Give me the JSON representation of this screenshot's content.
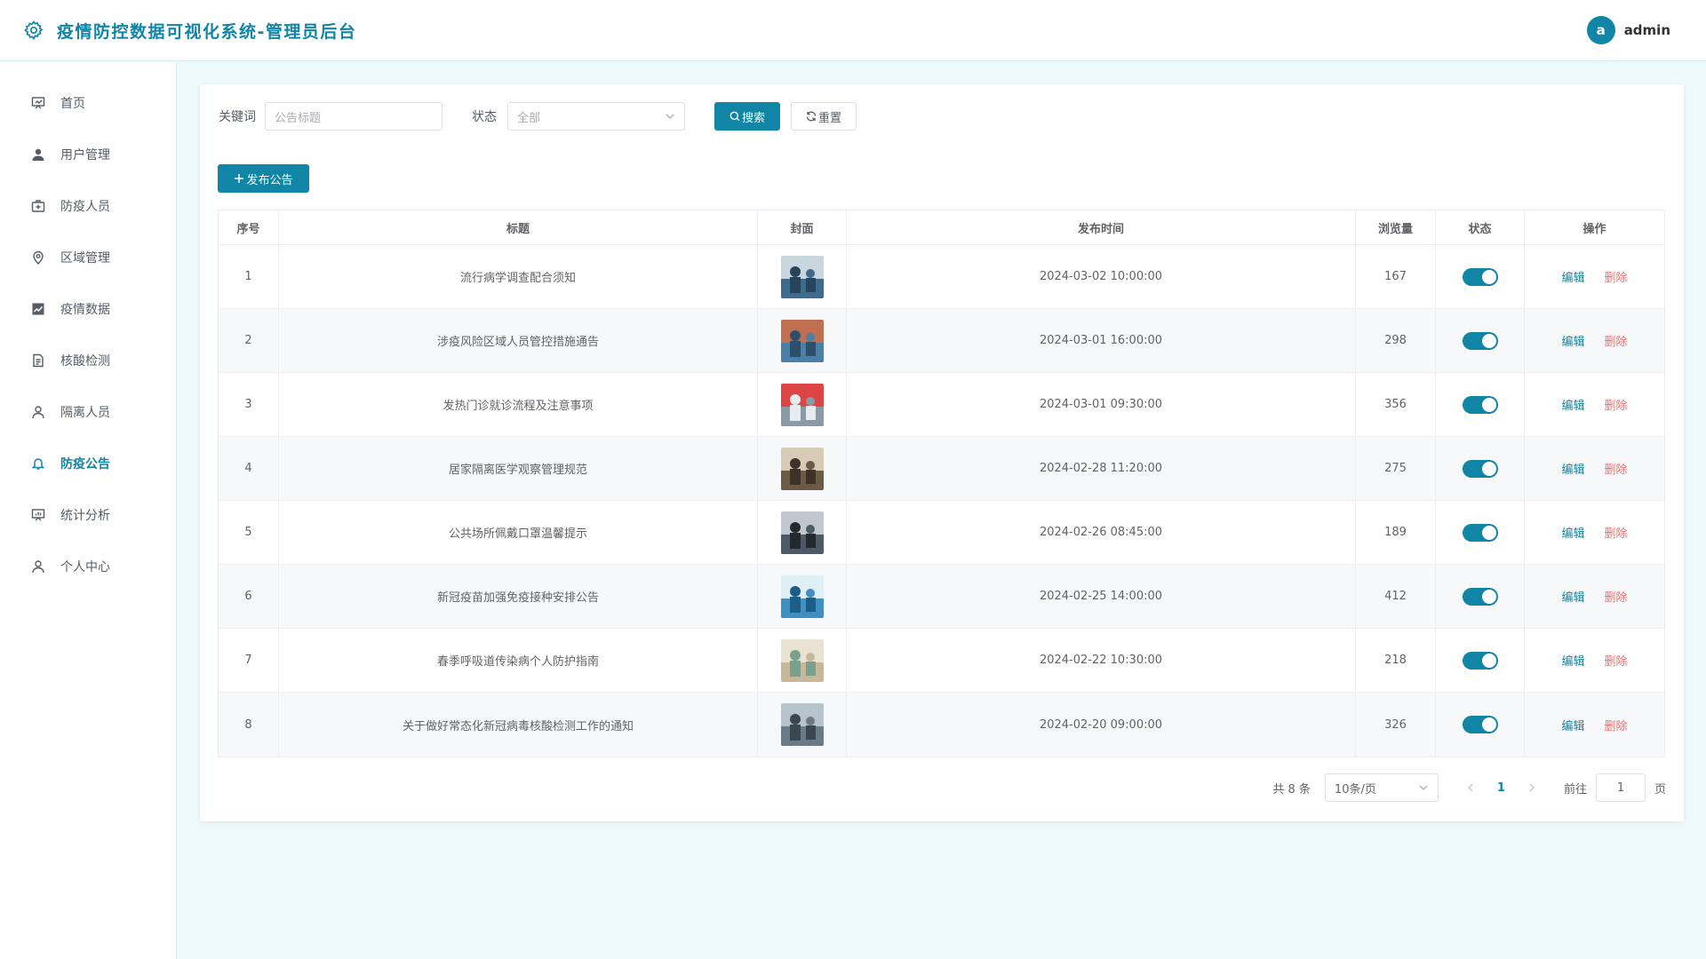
{
  "header": {
    "title": "疫情防控数据可视化系统-管理员后台",
    "avatar_letter": "a",
    "username": "admin"
  },
  "sidebar": {
    "items": [
      {
        "label": "首页",
        "icon": "dashboard-icon"
      },
      {
        "label": "用户管理",
        "icon": "user-icon"
      },
      {
        "label": "防疫人员",
        "icon": "medical-kit-icon"
      },
      {
        "label": "区域管理",
        "icon": "location-icon"
      },
      {
        "label": "疫情数据",
        "icon": "chart-icon"
      },
      {
        "label": "核酸检测",
        "icon": "document-icon"
      },
      {
        "label": "隔离人员",
        "icon": "person-icon"
      },
      {
        "label": "防疫公告",
        "icon": "bell-icon",
        "active": true
      },
      {
        "label": "统计分析",
        "icon": "analysis-icon"
      },
      {
        "label": "个人中心",
        "icon": "profile-icon"
      }
    ]
  },
  "filters": {
    "keyword_label": "关键词",
    "keyword_placeholder": "公告标题",
    "status_label": "状态",
    "status_value": "全部",
    "search_label": "搜索",
    "reset_label": "重置"
  },
  "toolbar": {
    "publish_label": "发布公告"
  },
  "table": {
    "columns": [
      "序号",
      "标题",
      "封面",
      "发布时间",
      "浏览量",
      "状态",
      "操作"
    ],
    "edit_label": "编辑",
    "delete_label": "删除",
    "rows": [
      {
        "no": "1",
        "title": "流行病学调查配合须知",
        "time": "2024-03-02 10:00:00",
        "views": "167",
        "status_on": true
      },
      {
        "no": "2",
        "title": "涉疫风险区域人员管控措施通告",
        "time": "2024-03-01 16:00:00",
        "views": "298",
        "status_on": true
      },
      {
        "no": "3",
        "title": "发热门诊就诊流程及注意事项",
        "time": "2024-03-01 09:30:00",
        "views": "356",
        "status_on": true
      },
      {
        "no": "4",
        "title": "居家隔离医学观察管理规范",
        "time": "2024-02-28 11:20:00",
        "views": "275",
        "status_on": true
      },
      {
        "no": "5",
        "title": "公共场所佩戴口罩温馨提示",
        "time": "2024-02-26 08:45:00",
        "views": "189",
        "status_on": true
      },
      {
        "no": "6",
        "title": "新冠疫苗加强免疫接种安排公告",
        "time": "2024-02-25 14:00:00",
        "views": "412",
        "status_on": true
      },
      {
        "no": "7",
        "title": "春季呼吸道传染病个人防护指南",
        "time": "2024-02-22 10:30:00",
        "views": "218",
        "status_on": true
      },
      {
        "no": "8",
        "title": "关于做好常态化新冠病毒核酸检测工作的通知",
        "time": "2024-02-20 09:00:00",
        "views": "326",
        "status_on": true
      }
    ]
  },
  "pagination": {
    "total_text": "共 8 条",
    "page_size": "10条/页",
    "current_page": "1",
    "goto_label": "前往",
    "goto_value": "1",
    "page_suffix": "页"
  },
  "colors": {
    "accent": "#1185a5",
    "danger": "#f56c6c",
    "background": "#eef9fb"
  }
}
